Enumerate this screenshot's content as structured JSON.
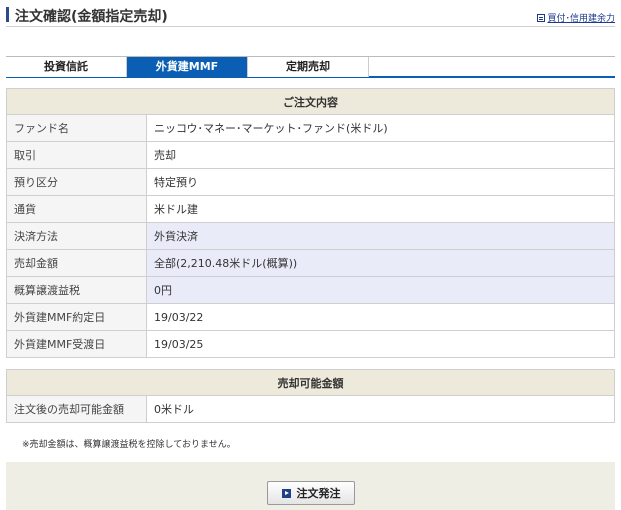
{
  "header": {
    "title": "注文確認(金額指定売却)",
    "link_label": "買付･信用建余力"
  },
  "tabs": [
    {
      "label": "投資信託",
      "active": false
    },
    {
      "label": "外貨建MMF",
      "active": true
    },
    {
      "label": "定期売却",
      "active": false
    }
  ],
  "order": {
    "heading": "ご注文内容",
    "rows": [
      {
        "label": "ファンド名",
        "value": "ニッコウ･マネー･マーケット･ファンド(米ドル)"
      },
      {
        "label": "取引",
        "value": "売却"
      },
      {
        "label": "預り区分",
        "value": "特定預り"
      },
      {
        "label": "通貨",
        "value": "米ドル建"
      },
      {
        "label": "決済方法",
        "value": "外貨決済"
      },
      {
        "label": "売却金額",
        "value": "全部(2,210.48米ドル(概算))"
      },
      {
        "label": "概算譲渡益税",
        "value": "0円"
      },
      {
        "label": "外貨建MMF約定日",
        "value": "19/03/22"
      },
      {
        "label": "外貨建MMF受渡日",
        "value": "19/03/25"
      }
    ]
  },
  "available": {
    "heading": "売却可能金額",
    "rows": [
      {
        "label": "注文後の売却可能金額",
        "value": "0米ドル"
      }
    ]
  },
  "note": "※売却金額は、概算譲渡益税を控除しておりません。",
  "submit": {
    "label": "注文発注"
  },
  "colors": {
    "accent": "#0a5fb4",
    "section_header_bg": "#eeeadb",
    "highlight_row_bg": "#e9ecf8"
  }
}
